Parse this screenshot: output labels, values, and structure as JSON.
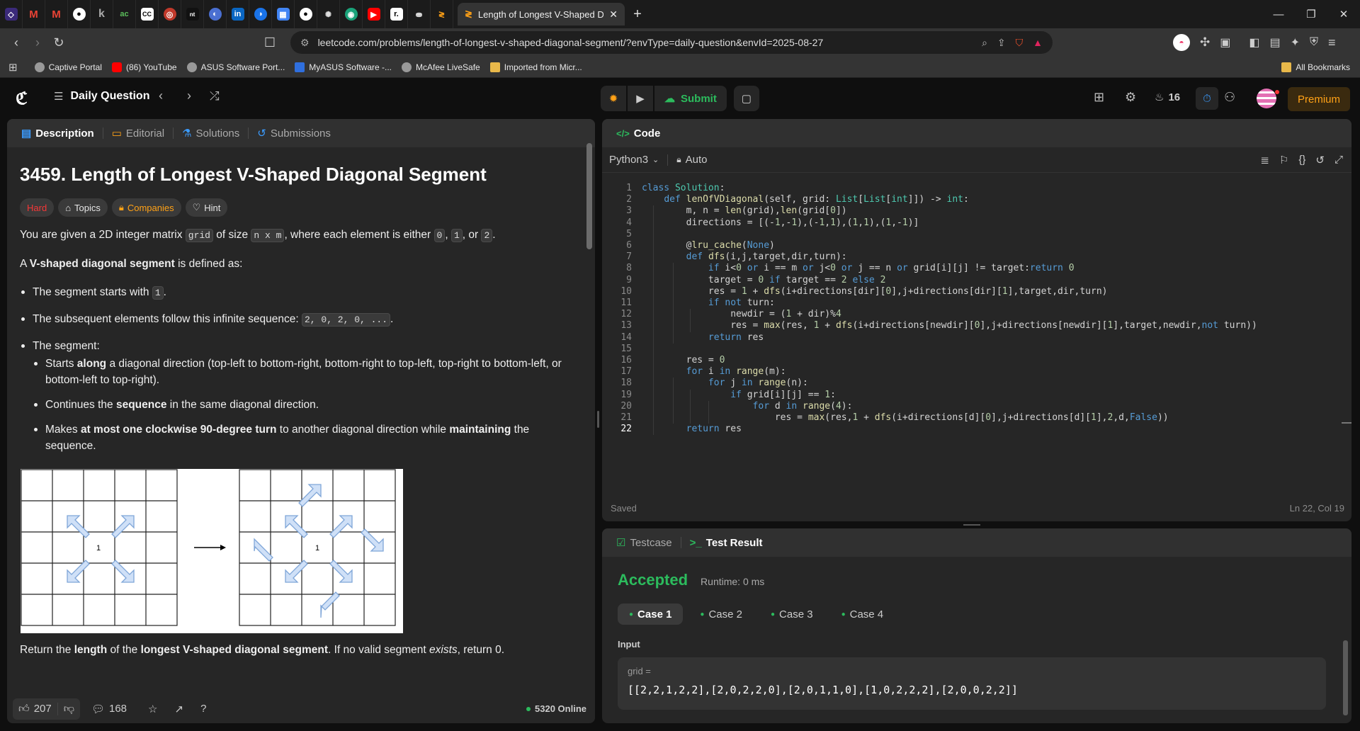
{
  "browser": {
    "active_tab_title": "Length of Longest V-Shaped Dia",
    "url": "leetcode.com/problems/length-of-longest-v-shaped-diagonal-segment/?envType=daily-question&envId=2025-08-27",
    "bookmarks": [
      "Captive Portal",
      "(86) YouTube",
      "ASUS Software Port...",
      "MyASUS Software -...",
      "McAfee LiveSafe",
      "Imported from Micr..."
    ],
    "all_bookmarks": "All Bookmarks",
    "pinned_tabs": [
      "lc",
      "M",
      "M",
      "gh",
      "k",
      "ac",
      "cc",
      "r",
      "nt",
      "ms",
      "in",
      "gd",
      "cal",
      "gh",
      "gpt",
      "wa",
      "yt",
      "r",
      "up",
      "lc"
    ]
  },
  "header": {
    "title": "Daily Question",
    "submit": "Submit",
    "streak": "16",
    "premium": "Premium"
  },
  "left_tabs": [
    "Description",
    "Editorial",
    "Solutions",
    "Submissions"
  ],
  "problem": {
    "title": "3459. Length of Longest V-Shaped Diagonal Segment",
    "difficulty": "Hard",
    "tags": [
      "Topics",
      "Companies",
      "Hint"
    ],
    "p1a": "You are given a 2D integer matrix ",
    "grid": "grid",
    "p1b": " of size ",
    "nxm": "n x m",
    "p1c": ", where each element is either ",
    "v0": "0",
    "c1": ", ",
    "v1": "1",
    "c2": ", or ",
    "v2": "2",
    "p1d": ".",
    "p2a": "A ",
    "p2b": "V-shaped diagonal segment",
    "p2c": " is defined as:",
    "b1a": "The segment starts with ",
    "b1v": "1",
    "b1c": ".",
    "b2a": "The subsequent elements follow this infinite sequence: ",
    "b2v": "2, 0, 2, 0, ...",
    "b2c": ".",
    "b3": "The segment:",
    "s1a": "Starts ",
    "s1b": "along",
    "s1c": " a diagonal direction (top-left to bottom-right, bottom-right to top-left, top-right to bottom-left, or bottom-left to top-right).",
    "s2a": "Continues the ",
    "s2b": "sequence",
    "s2c": " in the same diagonal direction.",
    "s3a": "Makes ",
    "s3b": "at most one clockwise 90-degree turn",
    "s3c": " to another diagonal direction while ",
    "s3d": "maintaining",
    "s3e": " the sequence.",
    "ra": "Return the ",
    "rb": "length",
    "rc": " of the ",
    "rd": "longest V-shaped diagonal segment",
    "re": ". If no valid segment ",
    "rf": "exists",
    "rg": ", return 0.",
    "fig_cell": "1"
  },
  "footer": {
    "likes": "207",
    "comments": "168",
    "online": "5320 Online"
  },
  "code": {
    "tab": "Code",
    "lang": "Python3",
    "auto": "Auto",
    "saved": "Saved",
    "cursor": "Ln 22, Col 19",
    "lines": [
      "class Solution:",
      "    def lenOfVDiagonal(self, grid: List[List[int]]) -> int:",
      "        m, n = len(grid),len(grid[0])",
      "        directions = [(-1,-1),(-1,1),(1,1),(1,-1)]",
      "",
      "        @lru_cache(None)",
      "        def dfs(i,j,target,dir,turn):",
      "            if i<0 or i == m or j<0 or j == n or grid[i][j] != target:return 0",
      "            target = 0 if target == 2 else 2",
      "            res = 1 + dfs(i+directions[dir][0],j+directions[dir][1],target,dir,turn)",
      "            if not turn:",
      "                newdir = (1 + dir)%4",
      "                res = max(res, 1 + dfs(i+directions[newdir][0],j+directions[newdir][1],target,newdir,not turn))",
      "            return res",
      "",
      "        res = 0",
      "        for i in range(m):",
      "            for j in range(n):",
      "                if grid[i][j] == 1:",
      "                    for d in range(4):",
      "                        res = max(res,1 + dfs(i+directions[d][0],j+directions[d][1],2,d,False))",
      "        return res"
    ]
  },
  "result": {
    "tabs": [
      "Testcase",
      "Test Result"
    ],
    "status": "Accepted",
    "runtime": "Runtime: 0 ms",
    "cases": [
      "Case 1",
      "Case 2",
      "Case 3",
      "Case 4"
    ],
    "input_label": "Input",
    "var": "grid =",
    "value": "[[2,2,1,2,2],[2,0,2,2,0],[2,0,1,1,0],[1,0,2,2,2],[2,0,0,2,2]]"
  },
  "colors": {
    "accent": "#ffa116",
    "accepted": "#2cbb5d",
    "hard": "#f63737",
    "submit": "#2cbb5d"
  }
}
